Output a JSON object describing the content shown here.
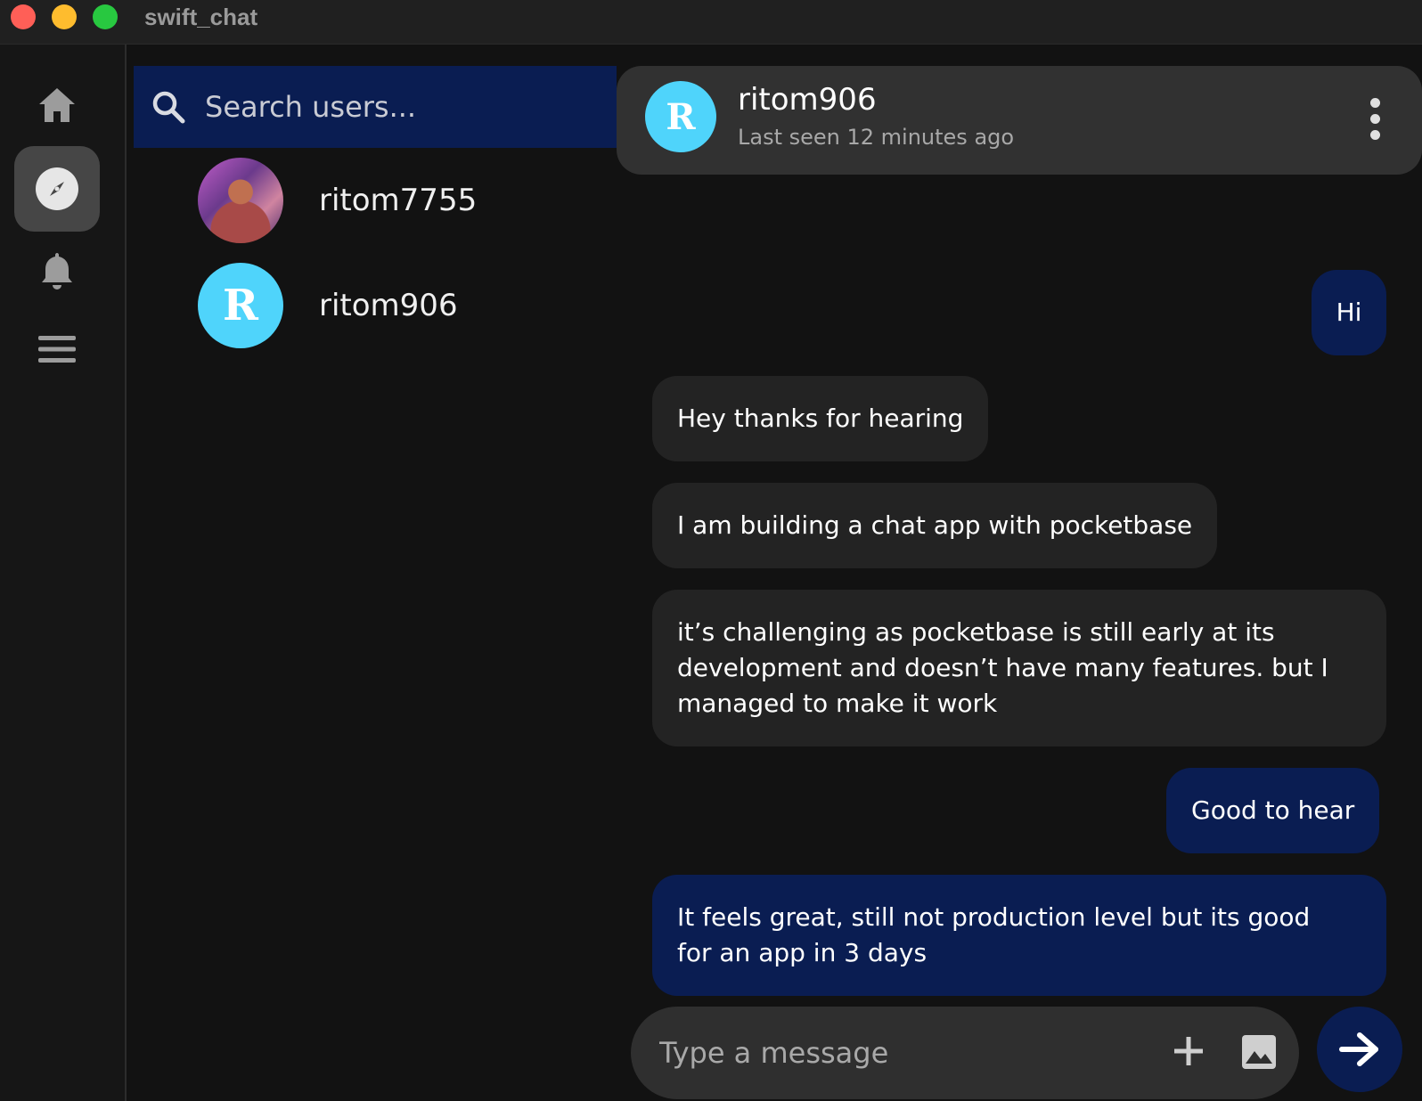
{
  "window": {
    "title": "swift_chat"
  },
  "nav": {
    "items": [
      {
        "icon": "home-icon"
      },
      {
        "icon": "compass-icon",
        "active": true
      },
      {
        "icon": "bell-icon"
      },
      {
        "icon": "menu-icon"
      }
    ]
  },
  "search": {
    "placeholder": "Search users..."
  },
  "users": [
    {
      "name": "ritom7755",
      "avatar": "photo"
    },
    {
      "name": "ritom906",
      "avatar_letter": "R"
    }
  ],
  "chat": {
    "header": {
      "avatar_letter": "R",
      "name": "ritom906",
      "status": "Last seen 12 minutes ago"
    },
    "messages": [
      {
        "direction": "out",
        "text": "Hi"
      },
      {
        "direction": "in",
        "text": "Hey thanks for hearing"
      },
      {
        "direction": "in",
        "text": "I am building a chat app with pocketbase"
      },
      {
        "direction": "in",
        "text": "it’s challenging as pocketbase is still early at its development and doesn’t have many features. but I managed to make it work"
      },
      {
        "direction": "out",
        "text": "Good to hear"
      },
      {
        "direction": "out",
        "text": "It feels great, still not production level but its good for an app in 3 days"
      }
    ]
  },
  "composer": {
    "placeholder": "Type a message"
  },
  "colors": {
    "background": "#121212",
    "accent": "#0a1d52",
    "avatar": "#4fd4fb",
    "bubble_in": "#232323",
    "header": "#313131"
  }
}
